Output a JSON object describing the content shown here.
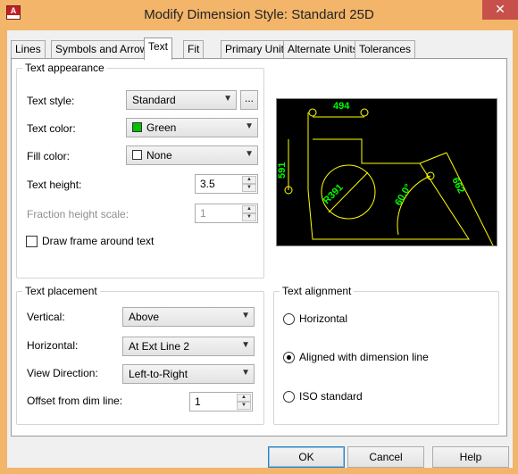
{
  "window": {
    "title": "Modify Dimension Style: Standard 25D",
    "close_glyph": "✕",
    "app_icon_letter": "A"
  },
  "tabs": [
    {
      "label": "Lines",
      "active": false
    },
    {
      "label": "Symbols and Arrows",
      "active": false
    },
    {
      "label": "Text",
      "active": true
    },
    {
      "label": "Fit",
      "active": false
    },
    {
      "label": "Primary Units",
      "active": false
    },
    {
      "label": "Alternate Units",
      "active": false
    },
    {
      "label": "Tolerances",
      "active": false
    }
  ],
  "text_appearance": {
    "title": "Text appearance",
    "text_style_label": "Text style:",
    "text_style_value": "Standard",
    "browse_label": "...",
    "text_color_label": "Text color:",
    "text_color_value": "Green",
    "text_color_swatch": "#00c000",
    "fill_color_label": "Fill color:",
    "fill_color_value": "None",
    "text_height_label": "Text height:",
    "text_height_value": "3.5",
    "fraction_label": "Fraction height scale:",
    "fraction_value": "1",
    "draw_frame_label": "Draw frame around text",
    "draw_frame_checked": false
  },
  "preview": {
    "dims": [
      "494",
      "591",
      "R391",
      "60.0°",
      "662"
    ],
    "line_color": "#ffff00",
    "text_color": "#00ff00"
  },
  "text_placement": {
    "title": "Text placement",
    "vertical_label": "Vertical:",
    "vertical_value": "Above",
    "horizontal_label": "Horizontal:",
    "horizontal_value": "At Ext Line 2",
    "view_direction_label": "View Direction:",
    "view_direction_value": "Left-to-Right",
    "offset_label": "Offset from dim line:",
    "offset_value": "1"
  },
  "text_alignment": {
    "title": "Text alignment",
    "options": [
      {
        "label": "Horizontal",
        "selected": false
      },
      {
        "label": "Aligned with dimension line",
        "selected": true
      },
      {
        "label": "ISO standard",
        "selected": false
      }
    ]
  },
  "buttons": {
    "ok": "OK",
    "cancel": "Cancel",
    "help": "Help"
  }
}
